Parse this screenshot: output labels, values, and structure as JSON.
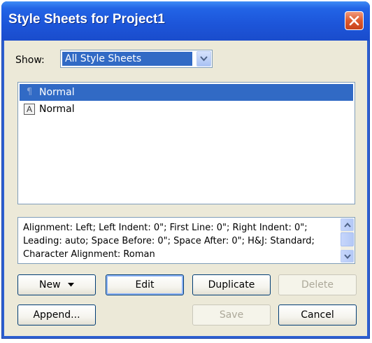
{
  "window": {
    "title": "Style Sheets for Project1"
  },
  "show": {
    "label": "Show:",
    "selected": "All Style Sheets"
  },
  "list": {
    "items": [
      {
        "label": "Normal",
        "icon": "paragraph-style-icon",
        "selected": true
      },
      {
        "label": "Normal",
        "icon": "character-style-icon",
        "selected": false
      }
    ],
    "char_icon_glyph": "A",
    "para_icon_glyph": "¶"
  },
  "description": {
    "text": "Alignment: Left;   Left Indent: 0\";   First Line: 0\";   Right Indent: 0\";   Leading: auto;   Space Before: 0\";   Space After: 0\";   H&J: Standard;   Character Alignment: Roman"
  },
  "buttons": {
    "new": "New",
    "edit": "Edit",
    "duplicate": "Duplicate",
    "delete": "Delete",
    "append": "Append...",
    "save": "Save",
    "cancel": "Cancel"
  },
  "colors": {
    "selection": "#316ac5",
    "titlebar": "#1d56da",
    "dialog_bg": "#ece9d8",
    "close": "#dd5a2d"
  }
}
